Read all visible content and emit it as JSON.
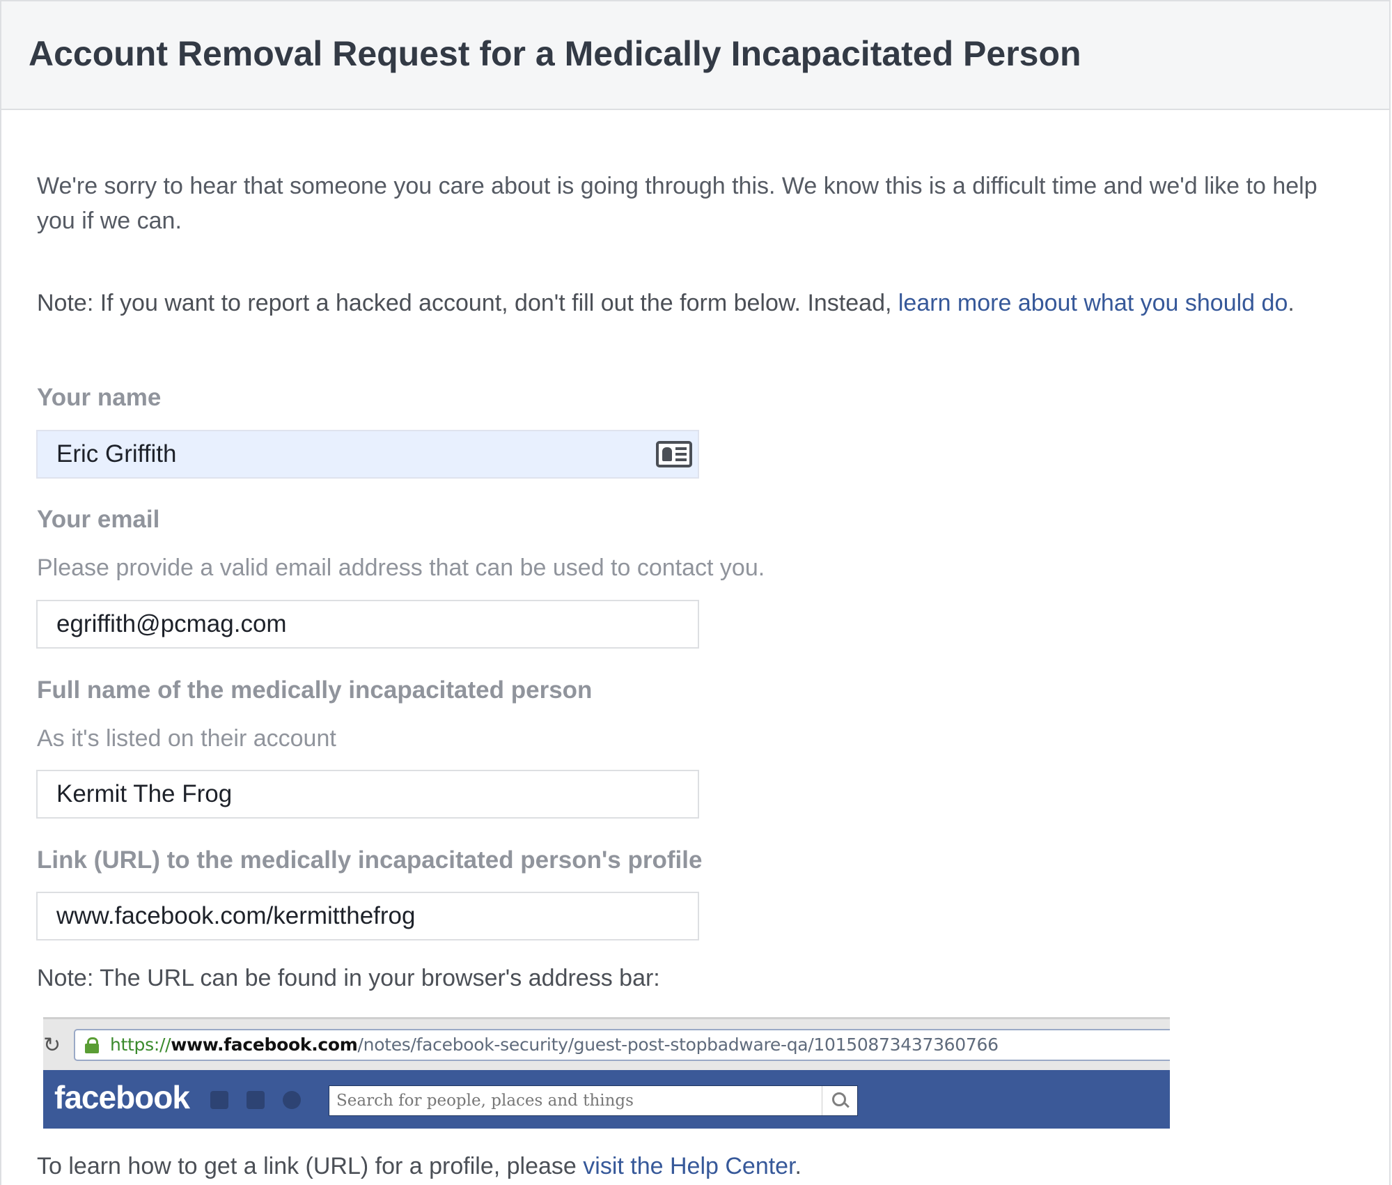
{
  "header": {
    "title": "Account Removal Request for a Medically Incapacitated Person"
  },
  "intro": {
    "text": "We're sorry to hear that someone you care about is going through this. We know this is a difficult time and we'd like to help you if we can."
  },
  "hacked_note": {
    "prefix": "Note: If you want to report a hacked account, don't fill out the form below. Instead, ",
    "link_text": "learn more about what you should do",
    "suffix": "."
  },
  "form": {
    "your_name": {
      "label": "Your name",
      "value": "Eric Griffith"
    },
    "your_email": {
      "label": "Your email",
      "help": "Please provide a valid email address that can be used to contact you.",
      "value": "egriffith@pcmag.com"
    },
    "full_name": {
      "label": "Full name of the medically incapacitated person",
      "help": "As it's listed on their account",
      "value": "Kermit The Frog"
    },
    "profile_url": {
      "label": "Link (URL) to the medically incapacitated person's profile",
      "value": "www.facebook.com/kermitthefrog"
    }
  },
  "url_note": "Note: The URL can be found in your browser's address bar:",
  "example_browser": {
    "url_scheme": "https://",
    "url_domain": "www.facebook.com",
    "url_path": "/notes/facebook-security/guest-post-stopbadware-qa/10150873437360766",
    "logo_text": "facebook",
    "search_placeholder": "Search for people, places and things",
    "reload_glyph": "↻"
  },
  "help_center": {
    "prefix": "To learn how to get a link (URL) for a profile, please ",
    "link_text": "visit the Help Center",
    "suffix": "."
  },
  "colors": {
    "link": "#365899",
    "label": "#90949c",
    "facebook_blue": "#3b5998",
    "autofill_bg": "#e8f0fe"
  }
}
